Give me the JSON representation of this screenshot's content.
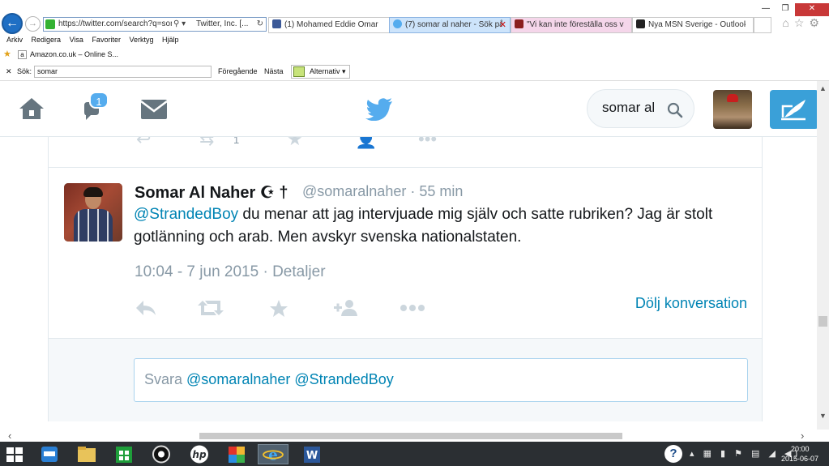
{
  "browser": {
    "address": {
      "url": "https://twitter.com/search?q=som",
      "site_label": "Twitter, Inc. [..."
    },
    "tabs": [
      {
        "label": "(1) Mohamed Eddie Omar",
        "icon": "facebook-icon"
      },
      {
        "label": "(7) somar al naher - Sök på ...",
        "icon": "twitter-icon",
        "active": true
      },
      {
        "label": "\"Vi kan inte föreställa oss vad s...",
        "icon": "news-icon"
      },
      {
        "label": "Nya MSN Sverige - Outlook, Sk...",
        "icon": "msn-icon"
      }
    ],
    "menu": [
      "Arkiv",
      "Redigera",
      "Visa",
      "Favoriter",
      "Verktyg",
      "Hjälp"
    ],
    "favorites": {
      "item": "Amazon.co.uk – Online S..."
    },
    "find": {
      "label": "Sök:",
      "value": "somar",
      "previous": "Föregående",
      "next": "Nästa",
      "options": "Alternativ"
    }
  },
  "twitter": {
    "header": {
      "notification_count": "1",
      "search_value": "somar al"
    },
    "previous_tweet": {
      "retweet_count": "1"
    },
    "tweet": {
      "author": "Somar Al Naher",
      "author_symbols": "☪ †",
      "handle": "@somaralnaher",
      "separator": "·",
      "age": "55 min",
      "mention": "@StrandedBoy",
      "text": " du menar att jag intervjuade mig själv och satte rubriken? Jag är stolt gotlänning och arab. Men avskyr svenska nationalstaten.",
      "timestamp": "10:04 - 7 jun 2015",
      "details": "Detaljer",
      "hide_conversation": "Dölj konversation"
    },
    "reply": {
      "prefix": "Svara ",
      "mention1": "@somaralnaher",
      "mention2": "@StrandedBoy"
    }
  },
  "taskbar": {
    "time": "20:00",
    "date": "2015-06-07"
  },
  "colors": {
    "twitter_blue": "#55acee",
    "link_blue": "#0084b4",
    "tweet_button": "#3aa0d8",
    "taskbar": "#2b2f33"
  }
}
